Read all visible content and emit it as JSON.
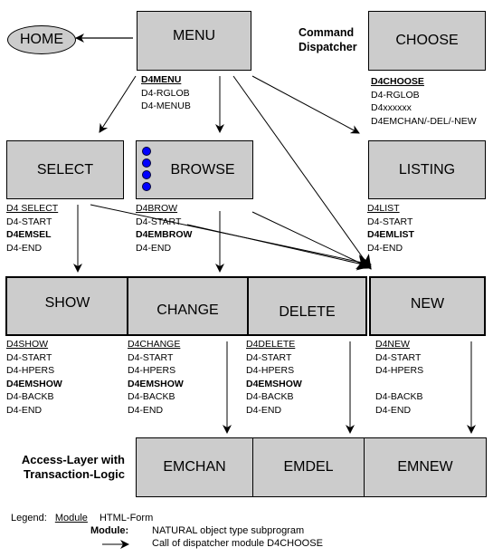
{
  "nodes": {
    "home": "HOME",
    "menu": "MENU",
    "choose": "CHOOSE",
    "select": "SELECT",
    "browse": "BROWSE",
    "listing": "LISTING",
    "show": "SHOW",
    "change": "CHANGE",
    "delete": "DELETE",
    "new": "NEW",
    "emchan": "EMCHAN",
    "emdel": "EMDEL",
    "emnew": "EMNEW"
  },
  "labels": {
    "command_dispatcher": [
      "Command",
      "Dispatcher"
    ],
    "access_layer": [
      "Access-Layer with",
      "Transaction-Logic"
    ]
  },
  "modules": {
    "menu": [
      "D4MENU",
      "D4-RGLOB",
      "D4-MENUB"
    ],
    "choose": [
      "D4CHOOSE",
      "D4-RGLOB",
      "D4xxxxxx",
      "D4EMCHAN/-DEL/-NEW"
    ],
    "select": [
      "D4 SELECT",
      "D4-START",
      "D4EMSEL",
      "D4-END"
    ],
    "browse": [
      "D4BROW",
      "D4-START",
      "D4EMBROW",
      "D4-END"
    ],
    "listing": [
      "D4LIST",
      "D4-START",
      "D4EMLIST",
      "D4-END"
    ],
    "show": [
      "D4SHOW",
      "D4-START",
      "D4-HPERS",
      "D4EMSHOW",
      "D4-BACKB",
      "D4-END"
    ],
    "change": [
      "D4CHANGE",
      "D4-START",
      "D4-HPERS",
      "D4EMSHOW",
      "D4-BACKB",
      "D4-END"
    ],
    "delete": [
      "D4DELETE",
      "D4-START",
      "D4-HPERS",
      "D4EMSHOW",
      "D4-BACKB",
      "D4-END"
    ],
    "new": [
      "D4NEW",
      "D4-START",
      "D4-HPERS",
      "",
      "D4-BACKB",
      "D4-END"
    ]
  },
  "legend": {
    "title": "Legend:",
    "module_word": "Module",
    "html_form": "HTML-Form",
    "module_label": "Module:",
    "module_desc": "NATURAL object type subprogram",
    "arrow_desc": "Call of dispatcher module D4CHOOSE"
  },
  "colors": {
    "box_fill": "#cccccc",
    "dot_fill": "#0000ff"
  }
}
